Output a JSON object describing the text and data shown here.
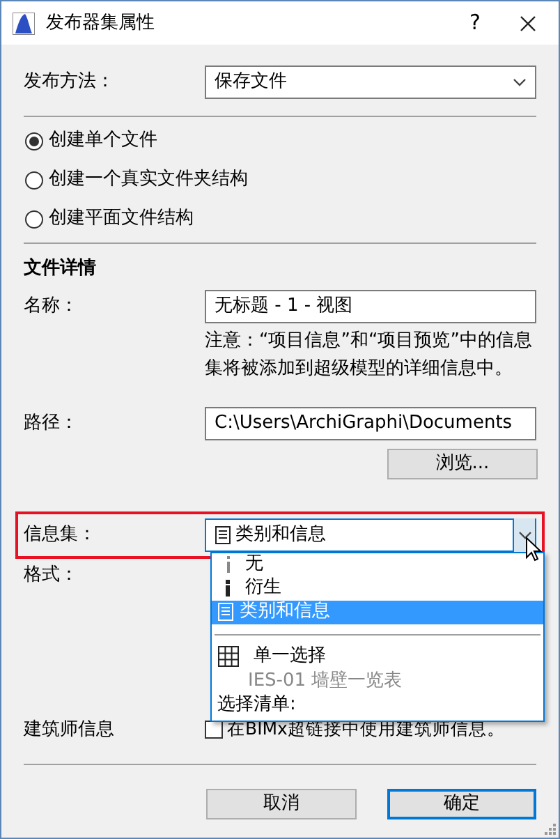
{
  "window": {
    "title": "发布器集属性",
    "help": "?"
  },
  "publish_method": {
    "label": "发布方法：",
    "value": "保存文件"
  },
  "radios": [
    {
      "label": "创建单个文件",
      "selected": true
    },
    {
      "label": "创建一个真实文件夹结构",
      "selected": false
    },
    {
      "label": "创建平面文件结构",
      "selected": false
    }
  ],
  "details": {
    "heading": "文件详情",
    "name_label": "名称：",
    "name_value": "无标题 - 1 - 视图",
    "note": "注意：“项目信息”和“项目预览”中的信息集将被添加到超级模型的详细信息中。",
    "path_label": "路径：",
    "path_value": "C:\\Users\\ArchiGraphi\\Documents",
    "browse": "浏览..."
  },
  "info_set": {
    "label": "信息集：",
    "value": "类别和信息",
    "expanded": true,
    "highlighted": true,
    "options": [
      {
        "kind": "info-light",
        "label": "无",
        "selected": false
      },
      {
        "kind": "info-bold",
        "label": "衍生",
        "selected": false
      },
      {
        "kind": "document",
        "label": "类别和信息",
        "selected": true
      },
      {
        "kind": "separator"
      },
      {
        "kind": "table",
        "label": "单一选择",
        "selected": false
      },
      {
        "kind": "sub",
        "label": "IES-01 墙壁一览表",
        "disabled": true
      },
      {
        "kind": "group",
        "label": "选择清单:"
      }
    ]
  },
  "format": {
    "label": "格式："
  },
  "architect": {
    "label": "建筑师信息",
    "checkbox": "在BIMx超链接中使用建筑师信息。",
    "checked": false
  },
  "buttons": [
    {
      "label": "取消",
      "default": false
    },
    {
      "label": "确定",
      "default": true
    }
  ]
}
